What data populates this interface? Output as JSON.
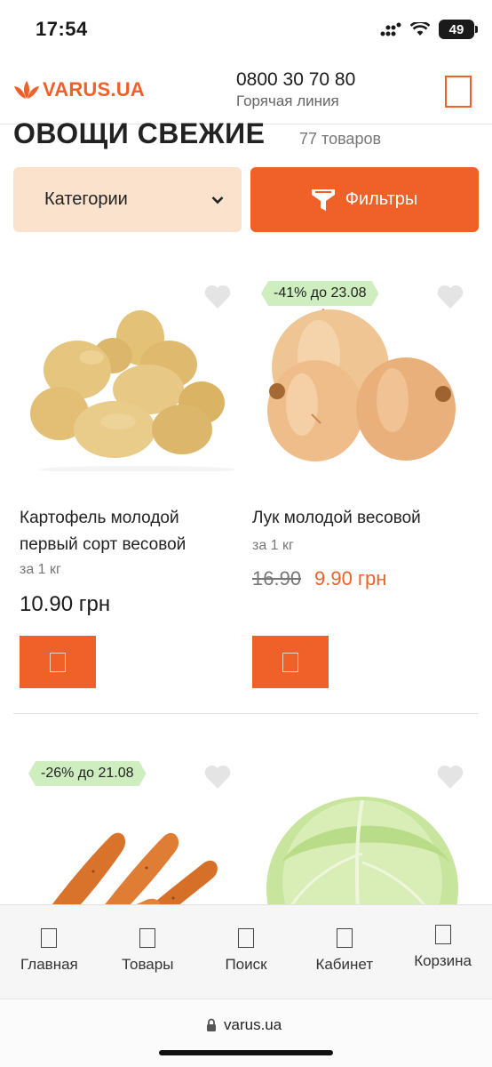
{
  "status_bar": {
    "time": "17:54",
    "battery": "49"
  },
  "header": {
    "logo_text": "VARUS.UA",
    "phone": "0800 30 70 80",
    "hotline_label": "Горячая линия"
  },
  "page": {
    "title": "ОВОЩИ СВЕЖИЕ",
    "count": "77 товаров"
  },
  "filters": {
    "categories_label": "Категории",
    "filters_label": "Фильтры"
  },
  "products": [
    {
      "name_line1": "Картофель молодой",
      "name_line2": "первый сорт весовой",
      "unit": "за 1 кг",
      "price": "10.90 грн",
      "badge": ""
    },
    {
      "name_line1": "Лук молодой весовой",
      "name_line2": "",
      "unit": "за 1 кг",
      "old_price": "16.90",
      "new_price": "9.90 грн",
      "badge": "-41% до 23.08"
    },
    {
      "badge": "-26% до 21.08"
    },
    {
      "badge": ""
    }
  ],
  "bottom_nav": [
    {
      "label": "Главная",
      "icon": "home-icon"
    },
    {
      "label": "Товары",
      "icon": "catalog-icon"
    },
    {
      "label": "Поиск",
      "icon": "search-icon"
    },
    {
      "label": "Кабинет",
      "icon": "account-icon"
    },
    {
      "label": "Корзина",
      "icon": "cart-icon"
    }
  ],
  "browser": {
    "url": "varus.ua"
  },
  "colors": {
    "accent": "#f0612a",
    "accent_light": "#fbe2cd",
    "promo": "#cfeec0"
  }
}
